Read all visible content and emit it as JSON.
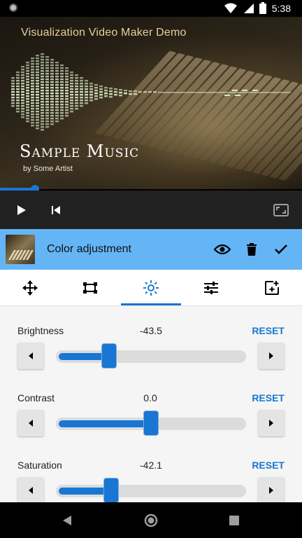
{
  "status_bar": {
    "time": "5:38"
  },
  "video": {
    "header_title": "Visualization Video Maker Demo",
    "music_title": "Sample Music",
    "artist": "by Some Artist",
    "progress": 0.115
  },
  "player": {
    "play_icon": "play-icon",
    "skip_previous_icon": "skip-previous-icon",
    "fullscreen_icon": "fullscreen-icon"
  },
  "effect": {
    "title": "Color adjustment",
    "preview_icon": "eye-icon",
    "delete_icon": "trash-icon",
    "confirm_icon": "check-icon"
  },
  "tabs": [
    {
      "icon": "move-icon"
    },
    {
      "icon": "crop-icon"
    },
    {
      "icon": "brightness-icon",
      "active": true
    },
    {
      "icon": "sliders-icon"
    },
    {
      "icon": "add-effect-icon"
    }
  ],
  "adjustments": [
    {
      "label": "Brightness",
      "value": "-43.5",
      "reset": "RESET",
      "level": 0.28
    },
    {
      "label": "Contrast",
      "value": "0.0",
      "reset": "RESET",
      "level": 0.5
    },
    {
      "label": "Saturation",
      "value": "-42.1",
      "reset": "RESET",
      "level": 0.29
    }
  ],
  "colors": {
    "accent": "#1976d2",
    "effect_header": "#64b5f6",
    "title_gold": "#e6d09a"
  }
}
